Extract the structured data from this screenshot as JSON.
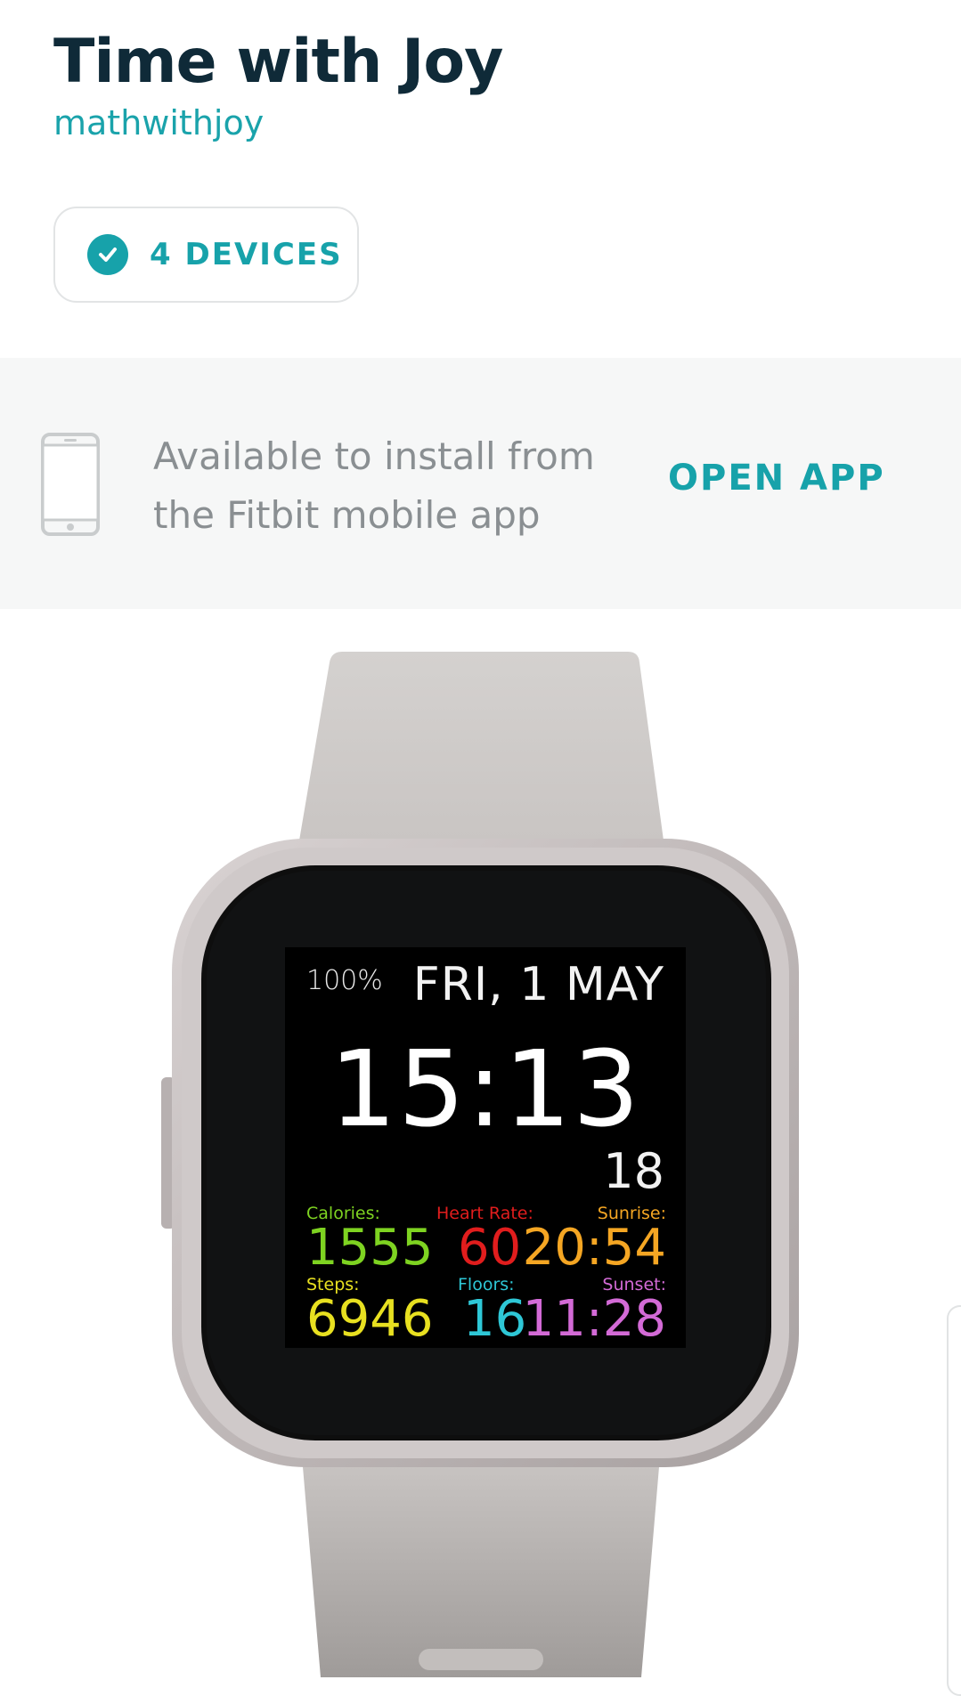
{
  "header": {
    "title": "Time with Joy",
    "developer": "mathwithjoy"
  },
  "devices": {
    "label": "4 DEVICES",
    "icon": "check-circle-icon"
  },
  "install": {
    "line1": "Available to install from",
    "line2": "the Fitbit mobile app",
    "action": "OPEN APP",
    "icon": "phone-icon"
  },
  "watch_face": {
    "battery": "100%",
    "date": "FRI, 1 MAY",
    "time": "15:13",
    "seconds": "18",
    "stats": {
      "calories": {
        "label": "Calories:",
        "value": "1555",
        "color": "#7ed321"
      },
      "heart_rate": {
        "label": "Heart Rate:",
        "value": "60",
        "color": "#e11d1d"
      },
      "sunrise": {
        "label": "Sunrise:",
        "value": "20:54",
        "color": "#f5a623"
      },
      "steps": {
        "label": "Steps:",
        "value": "6946",
        "color": "#e8e020"
      },
      "floors": {
        "label": "Floors:",
        "value": "16",
        "color": "#2ec7d6"
      },
      "sunset": {
        "label": "Sunset:",
        "value": "11:28",
        "color": "#d36ad6"
      }
    }
  },
  "colors": {
    "accent": "#17a2aa",
    "title": "#0f2a38",
    "banner_bg": "#f6f7f7"
  }
}
